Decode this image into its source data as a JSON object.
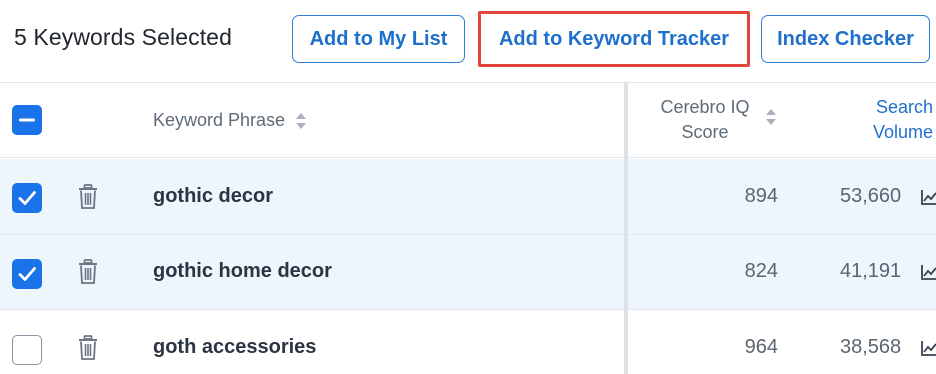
{
  "toolbar": {
    "selected_count": "5 Keywords Selected",
    "add_to_my_list": "Add to My List",
    "add_to_keyword_tracker": "Add to Keyword Tracker",
    "index_checker": "Index Checker"
  },
  "table": {
    "headers": {
      "keyword_phrase": "Keyword Phrase",
      "cerebro_iq_line1": "Cerebro IQ",
      "cerebro_iq_line2": "Score",
      "search_volume_line1": "Search",
      "search_volume_line2": "Volume"
    },
    "rows": [
      {
        "keyword": "gothic decor",
        "cerebro_iq": "894",
        "search_volume": "53,660",
        "checked": true
      },
      {
        "keyword": "gothic home decor",
        "cerebro_iq": "824",
        "search_volume": "41,191",
        "checked": true
      },
      {
        "keyword": "goth accessories",
        "cerebro_iq": "964",
        "search_volume": "38,568",
        "checked": false
      }
    ]
  },
  "colors": {
    "accent": "#1a73e8",
    "highlight_border": "#e2463a",
    "selected_row_bg": "#edf6fd"
  },
  "icons": [
    "checkbox-indeterminate-icon",
    "checkbox-checked-icon",
    "checkbox-empty-icon",
    "trash-icon",
    "sort-icon",
    "trend-chart-icon"
  ]
}
